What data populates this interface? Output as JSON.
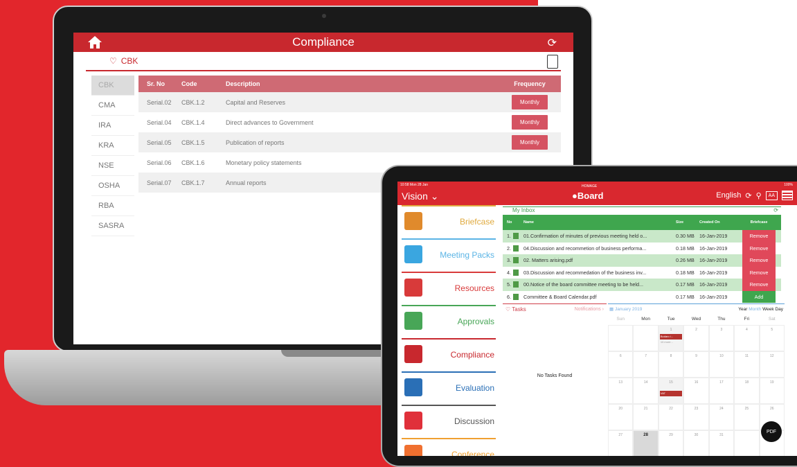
{
  "laptop": {
    "header_title": "Compliance",
    "breadcrumb": "CBK",
    "sidebar": [
      "CBK",
      "CMA",
      "IRA",
      "KRA",
      "NSE",
      "OSHA",
      "RBA",
      "SASRA"
    ],
    "columns": [
      "Sr. No",
      "Code",
      "Description",
      "Frequency"
    ],
    "rows": [
      {
        "sr": "Serial.02",
        "code": "CBK.1.2",
        "desc": "Capital and Reserves",
        "freq": "Monthly"
      },
      {
        "sr": "Serial.04",
        "code": "CBK.1.4",
        "desc": "Direct advances to Government",
        "freq": "Monthly"
      },
      {
        "sr": "Serial.05",
        "code": "CBK.1.5",
        "desc": "Publication of reports",
        "freq": "Monthly"
      },
      {
        "sr": "Serial.06",
        "code": "CBK.1.6",
        "desc": "Monetary policy statements",
        "freq": ""
      },
      {
        "sr": "Serial.07",
        "code": "CBK.1.7",
        "desc": "Annual reports",
        "freq": ""
      }
    ]
  },
  "tablet": {
    "status_time": "10:58  Mon 28 Jan",
    "status_battery": "100%",
    "title": "Vision",
    "logo_top": "HOMAGE",
    "logo": "Board",
    "language": "English",
    "font_btn": "AA",
    "menu": [
      {
        "label": "Briefcase",
        "color": "#e0aa3e",
        "icon_color": "#e08a2c"
      },
      {
        "label": "Meeting Packs",
        "color": "#5ab4e5",
        "icon_color": "#3aa6e0"
      },
      {
        "label": "Resources",
        "color": "#d83a3a",
        "icon_color": "#d83a3a"
      },
      {
        "label": "Approvals",
        "color": "#48a657",
        "icon_color": "#48a657"
      },
      {
        "label": "Compliance",
        "color": "#c8282e",
        "icon_color": "#c8282e"
      },
      {
        "label": "Evaluation",
        "color": "#2a6fb6",
        "icon_color": "#2a6fb6"
      },
      {
        "label": "Discussion",
        "color": "#555555",
        "icon_color": "#e0303a"
      },
      {
        "label": "Conference",
        "color": "#f0a030",
        "icon_color": "#f07030"
      }
    ],
    "inbox": {
      "title": "My Inbox",
      "columns": [
        "No",
        "Name",
        "Size",
        "Created On",
        "Briefcase"
      ],
      "rows": [
        {
          "no": "1.",
          "name": "01.Confirmation of minutes of previous meeting held o...",
          "size": "0.30 MB",
          "date": "16-Jan-2019",
          "action": "Remove"
        },
        {
          "no": "2.",
          "name": "04.Discussion and recommetion of business performa...",
          "size": "0.18 MB",
          "date": "16-Jan-2019",
          "action": "Remove"
        },
        {
          "no": "3.",
          "name": "02. Matters arising.pdf",
          "size": "0.26 MB",
          "date": "16-Jan-2019",
          "action": "Remove"
        },
        {
          "no": "4.",
          "name": "03.Discussion and recommedation of the business inv...",
          "size": "0.18 MB",
          "date": "16-Jan-2019",
          "action": "Remove"
        },
        {
          "no": "5.",
          "name": "00.Notice of the board committee meeting to be held...",
          "size": "0.17 MB",
          "date": "16-Jan-2019",
          "action": "Remove"
        },
        {
          "no": "6.",
          "name": "Committee & Board Calendar.pdf",
          "size": "0.17 MB",
          "date": "16-Jan-2019",
          "action": "Add"
        }
      ]
    },
    "tasks": {
      "title": "Tasks",
      "notifications": "Notifications",
      "empty": "No Tasks Found"
    },
    "calendar": {
      "month": "January 2019",
      "views": [
        "Year",
        "Month",
        "Week",
        "Day"
      ],
      "days": [
        "Sun",
        "Mon",
        "Tue",
        "Wed",
        "Thu",
        "Fri",
        "Sat"
      ],
      "dates": [
        "",
        "",
        "1",
        "2",
        "3",
        "4",
        "5",
        "6",
        "7",
        "8",
        "9",
        "10",
        "11",
        "12",
        "13",
        "14",
        "15",
        "16",
        "17",
        "18",
        "19",
        "20",
        "21",
        "22",
        "23",
        "24",
        "25",
        "26",
        "27",
        "28",
        "29",
        "30",
        "31",
        "",
        ""
      ],
      "event1": "Bodaro i...",
      "event1_more": "10 more...",
      "event2": "VAT",
      "pdf": "PDF"
    }
  }
}
